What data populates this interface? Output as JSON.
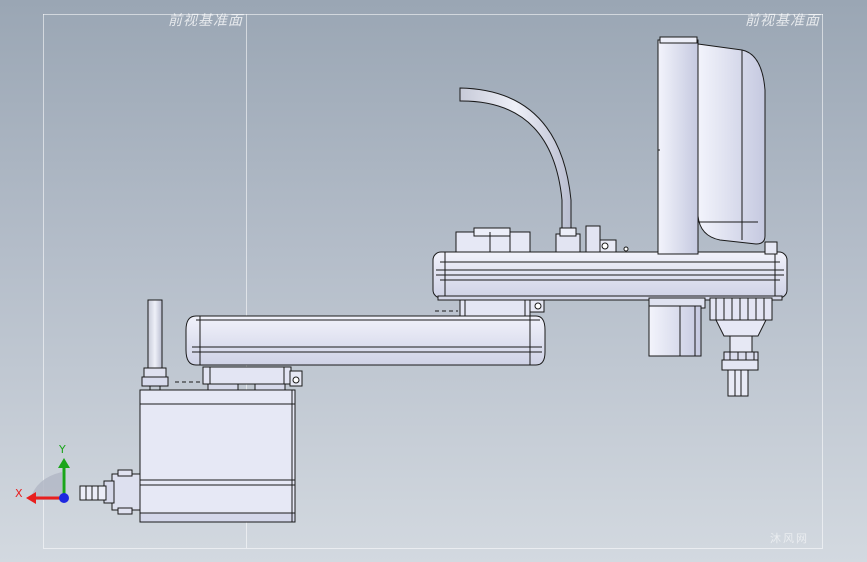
{
  "viewport": {
    "label_left": "前视基准面",
    "label_right": "前视基准面",
    "watermark": "沐风网"
  },
  "triad": {
    "x_label": "X",
    "y_label": "Y",
    "x_color": "#e81e1e",
    "y_color": "#1aa51a",
    "z_color": "#1e28e0"
  },
  "colors": {
    "body_fill": "#e4e6f4",
    "body_shade": "#c9cce0",
    "outline": "#1a1a1a"
  }
}
